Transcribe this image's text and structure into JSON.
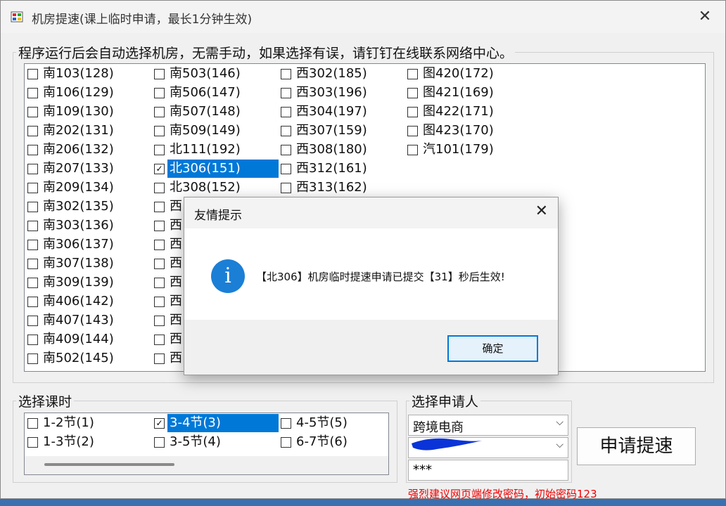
{
  "window": {
    "title": "机房提速(课上临时申请，最长1分钟生效)",
    "close": "✕"
  },
  "rooms": {
    "legend": "程序运行后会自动选择机房，无需手动，如果选择有误，请钉钉在线联系网络中心。",
    "columns": [
      [
        "南103(128)",
        "南106(129)",
        "南109(130)",
        "南202(131)",
        "南206(132)",
        "南207(133)",
        "南209(134)",
        "南302(135)",
        "南303(136)",
        "南306(137)",
        "南307(138)",
        "南309(139)",
        "南406(142)",
        "南407(143)",
        "南409(144)",
        "南502(145)"
      ],
      [
        "南503(146)",
        "南506(147)",
        "南507(148)",
        "南509(149)",
        "北111(192)",
        "北306(151)",
        "北308(152)",
        "西",
        "西",
        "西",
        "西",
        "西",
        "西",
        "西",
        "西",
        "西"
      ],
      [
        "西302(185)",
        "西303(196)",
        "西304(197)",
        "西307(159)",
        "西308(180)",
        "西312(161)",
        "西313(162)"
      ],
      [
        "图420(172)",
        "图421(169)",
        "图422(171)",
        "图423(170)",
        "汽101(179)"
      ]
    ],
    "selected": "北306(151)"
  },
  "periods": {
    "legend": "选择课时",
    "columns": [
      [
        "1-2节(1)",
        "1-3节(2)"
      ],
      [
        "3-4节(3)",
        "3-5节(4)"
      ],
      [
        "4-5节(5)",
        "6-7节(6)"
      ]
    ],
    "selected": "3-4节(3)"
  },
  "applicant": {
    "legend": "选择申请人",
    "department": "跨境电商",
    "password": "***",
    "warning": "强烈建议网页端修改密码，初始密码123"
  },
  "submit_label": "申请提速",
  "dialog": {
    "title": "友情提示",
    "close": "✕",
    "icon": "i",
    "message": "【北306】机房临时提速申请已提交【31】秒后生效!",
    "ok": "确定"
  },
  "colors": {
    "selection": "#0078d7",
    "warning": "#ee0000",
    "info": "#1b7fd6"
  },
  "icons": [
    "app-icon",
    "close-icon",
    "check-icon",
    "chevron-down-icon",
    "info-icon"
  ]
}
